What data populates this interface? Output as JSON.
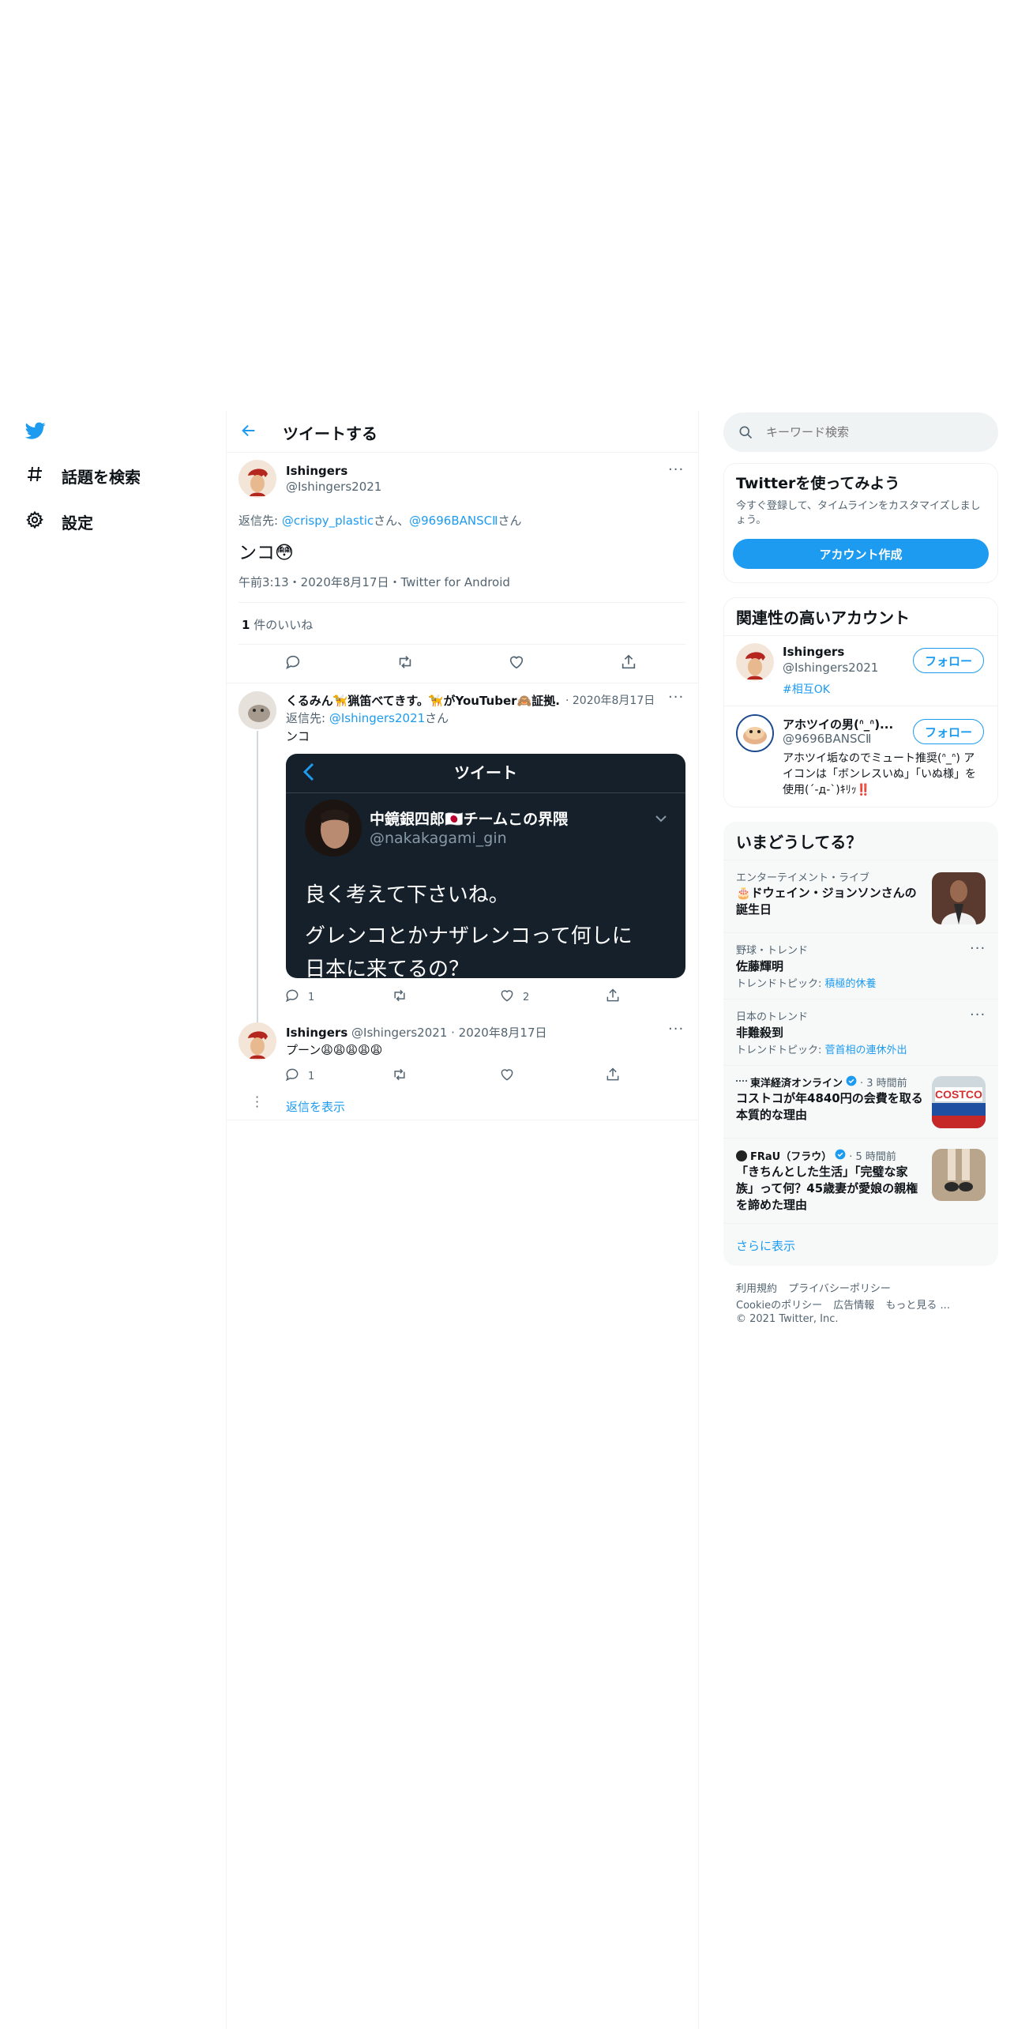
{
  "nav": {
    "explore_label": "話題を検索",
    "settings_label": "設定"
  },
  "header": {
    "title": "ツイートする"
  },
  "main_tweet": {
    "name": "Ishingers",
    "handle": "@Ishingers2021",
    "reply_prefix": "返信先: ",
    "reply_to_1": "@crispy_plastic",
    "reply_sep": "さん、",
    "reply_to_2": "@9696BANSCⅡ",
    "reply_suffix": "さん",
    "text": "ンコ😳",
    "meta": "午前3:13・2020年8月17日・Twitter for Android",
    "likes_count": "1",
    "likes_label": "件のいいね"
  },
  "reply1": {
    "name": "くるみん🦮猟笛べてきす。🦮がYouTuber🙈証拠...",
    "date": "· 2020年8月17日",
    "reply_prefix": "返信先: ",
    "reply_to": "@Ishingers2021",
    "reply_suffix": "さん",
    "text": "ンコ",
    "reply_count": "1",
    "like_count": "2",
    "image": {
      "header_title": "ツイート",
      "quoted_name": "中鏡銀四郎🇯🇵チームこの界隈",
      "quoted_handle": "@nakakagami_gin",
      "line1": "良く考えて下さいね。",
      "line2": "グレンコとかナザレンコって何しに",
      "line3": "日本に来てるの？"
    }
  },
  "reply2": {
    "name": "Ishingers",
    "handle": "@Ishingers2021",
    "date": "· 2020年8月17日",
    "text": "プーン😩😩😩😩😩",
    "reply_count": "1",
    "show_replies": "返信を表示"
  },
  "search": {
    "placeholder": "キーワード検索"
  },
  "signup": {
    "title": "Twitterを使ってみよう",
    "desc": "今すぐ登録して、タイムラインをカスタマイズしましょう。",
    "button": "アカウント作成"
  },
  "relevant": {
    "title": "関連性の高いアカウント",
    "follow_label": "フォロー",
    "accounts": [
      {
        "name": "Ishingers",
        "handle": "@Ishingers2021",
        "bio": "#相互OK"
      },
      {
        "name": "アホツイの男(ᐢ_ᐢ)...",
        "handle": "@9696BANSCⅡ",
        "bio": "アホツイ垢なのでミュート推奨(ᐢ_ᐢ) アイコンは「ボンレスいぬ」「いぬ様」を使用(´-д-`)ｷﾘｯ‼️"
      }
    ]
  },
  "trends": {
    "title": "いまどうしてる？",
    "items": [
      {
        "category": "エンターテイメント・ライブ",
        "title": "🎂ドウェイン・ジョンソンさんの誕生日"
      },
      {
        "category": "野球・トレンド",
        "title": "佐藤輝明",
        "topic_prefix": "トレンドトピック: ",
        "topic": "積極的休養"
      },
      {
        "category": "日本のトレンド",
        "title": "非難殺到",
        "topic_prefix": "トレンドトピック: ",
        "topic": "菅首相の連休外出"
      },
      {
        "source": "東洋経済オンライン",
        "time": "· 3 時間前",
        "title": "コストコが年4840円の会費を取る本質的な理由"
      },
      {
        "source": "FRaU（フラウ）",
        "time": "· 5 時間前",
        "title": "「きちんとした生活」「完璧な家族」って何？45歳妻が愛娘の親権を諦めた理由"
      }
    ],
    "show_more": "さらに表示"
  },
  "footer": {
    "terms": "利用規約",
    "privacy": "プライバシーポリシー",
    "cookie": "Cookieのポリシー",
    "ads": "広告情報",
    "more": "もっと見る ...",
    "copyright": "© 2021 Twitter, Inc."
  },
  "colors": {
    "accent": "#1d9bf0",
    "muted": "#536471",
    "card_bg": "#f7f9f9"
  }
}
